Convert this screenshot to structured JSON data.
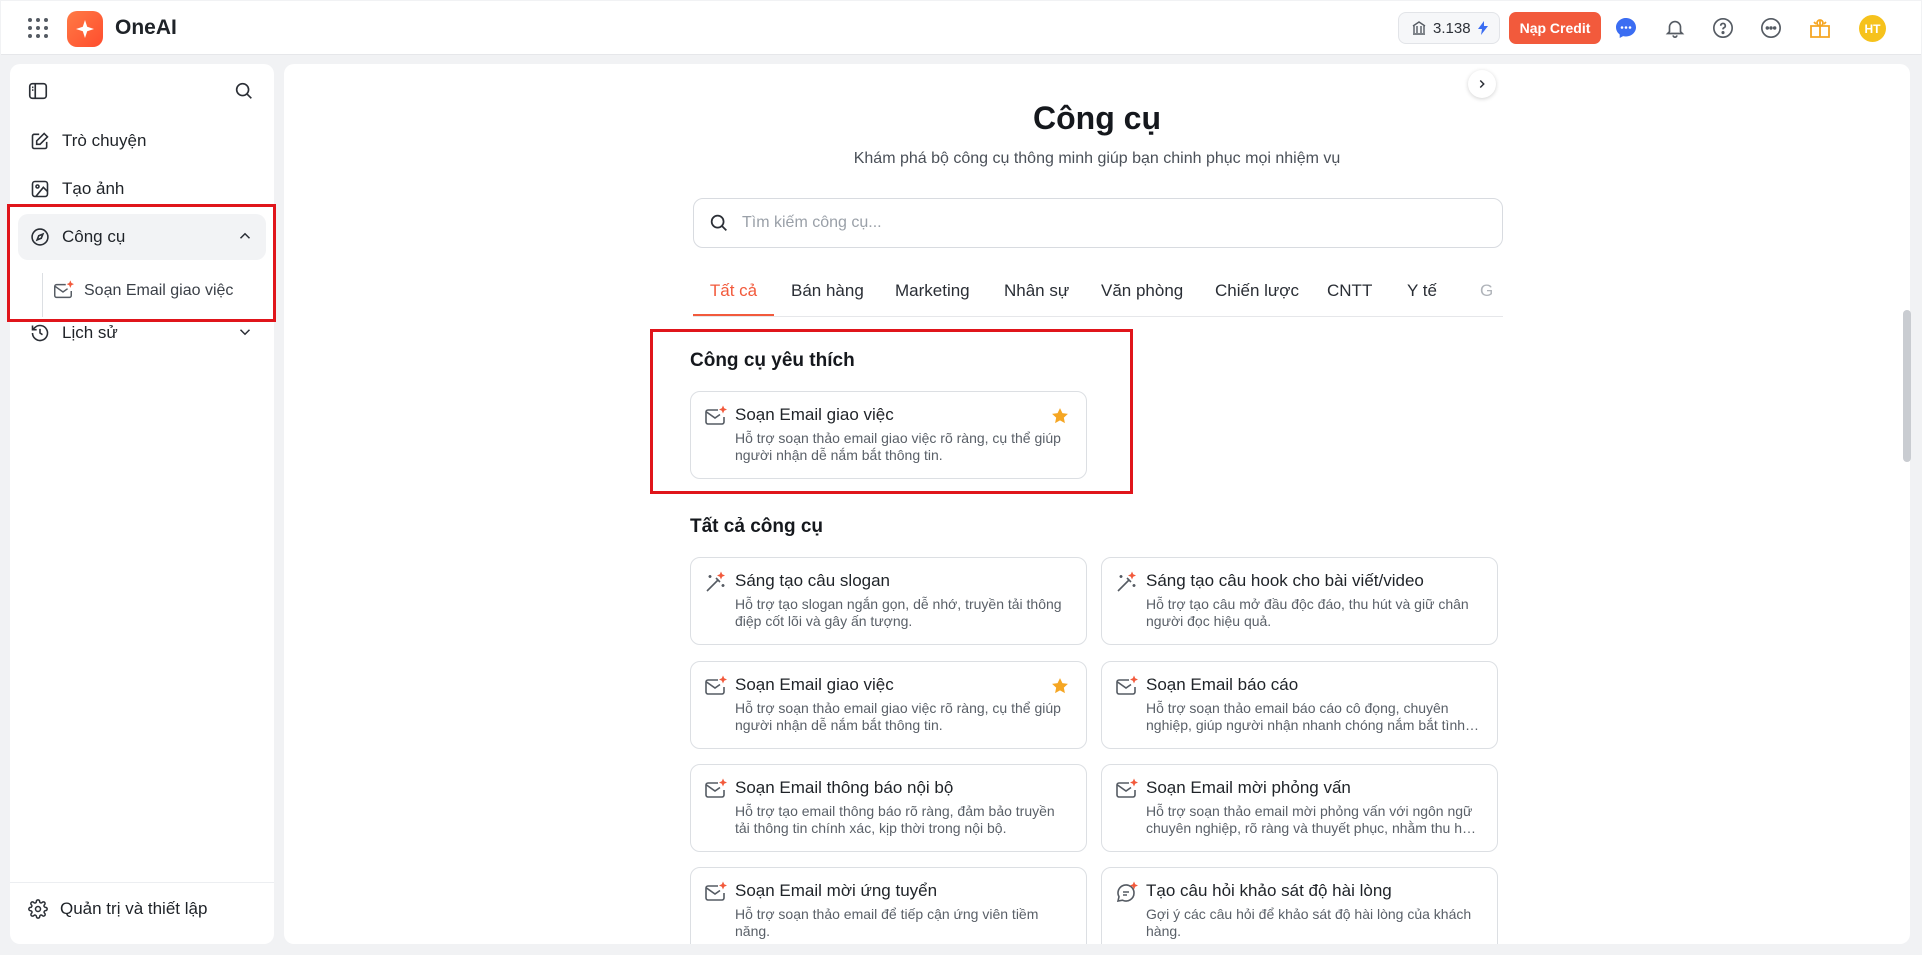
{
  "header": {
    "brand": "OneAI",
    "credit_value": "3.138",
    "recharge_label": "Nạp Credit",
    "avatar_initials": "HT",
    "accent_color": "#f25a3c"
  },
  "sidebar": {
    "items": [
      {
        "label": "Trò chuyện",
        "icon": "edit-icon"
      },
      {
        "label": "Tạo ảnh",
        "icon": "image-icon"
      },
      {
        "label": "Công cụ",
        "icon": "compass-icon",
        "expanded": true
      },
      {
        "label": "Lịch sử",
        "icon": "history-icon"
      }
    ],
    "sub_item": "Soạn Email giao việc",
    "settings_label": "Quản trị và thiết lập"
  },
  "main": {
    "title": "Công cụ",
    "subtitle": "Khám phá bộ công cụ thông minh giúp bạn chinh phục mọi nhiệm vụ",
    "search_placeholder": "Tìm kiếm công cụ...",
    "tabs": [
      "Tất cả",
      "Bán hàng",
      "Marketing",
      "Nhân sự",
      "Văn phòng",
      "Chiến lược",
      "CNTT",
      "Y tế",
      "G"
    ],
    "active_tab": "Tất cả",
    "favorites_title": "Công cụ yêu thích",
    "favorites": [
      {
        "title": "Soạn Email giao việc",
        "desc": "Hỗ trợ soạn thảo email giao việc rõ ràng, cụ thể giúp người nhận dễ nắm bắt thông tin.",
        "starred": true
      }
    ],
    "all_title": "Tất cả công cụ",
    "tools": [
      {
        "title": "Sáng tạo câu slogan",
        "desc": "Hỗ trợ tạo slogan ngắn gọn, dễ nhớ, truyền tải thông điệp cốt lõi và gây ấn tượng.",
        "icon": "magic-wand-icon",
        "starred": false
      },
      {
        "title": "Sáng tạo câu hook cho bài viết/video",
        "desc": "Hỗ trợ tạo câu mở đầu độc đáo, thu hút và giữ chân người đọc hiệu quả.",
        "icon": "magic-wand-icon",
        "starred": false
      },
      {
        "title": "Soạn Email giao việc",
        "desc": "Hỗ trợ soạn thảo email giao việc rõ ràng, cụ thể giúp người nhận dễ nắm bắt thông tin.",
        "icon": "mail-icon",
        "starred": true
      },
      {
        "title": "Soạn Email báo cáo",
        "desc": "Hỗ trợ soạn thảo email báo cáo cô đọng, chuyên nghiệp, giúp người nhận nhanh chóng nắm bắt tình hình.",
        "icon": "mail-icon",
        "starred": false
      },
      {
        "title": "Soạn Email thông báo nội bộ",
        "desc": "Hỗ trợ tạo email thông báo rõ ràng, đảm bảo truyền tải thông tin chính xác, kịp thời trong nội bộ.",
        "icon": "mail-icon",
        "starred": false
      },
      {
        "title": "Soạn Email mời phỏng vấn",
        "desc": "Hỗ trợ soạn thảo email mời phỏng vấn với ngôn ngữ chuyên nghiệp, rõ ràng và thuyết phục, nhằm thu hút ứng viên.",
        "icon": "mail-icon",
        "starred": false
      },
      {
        "title": "Soạn Email mời ứng tuyển",
        "desc": "Hỗ trợ soạn thảo email để tiếp cận ứng viên tiềm năng.",
        "icon": "mail-icon",
        "starred": false
      },
      {
        "title": "Tạo câu hỏi khảo sát độ hài lòng",
        "desc": "Gợi ý các câu hỏi để khảo sát độ hài lòng của khách hàng.",
        "icon": "chat-icon",
        "starred": false
      }
    ]
  }
}
